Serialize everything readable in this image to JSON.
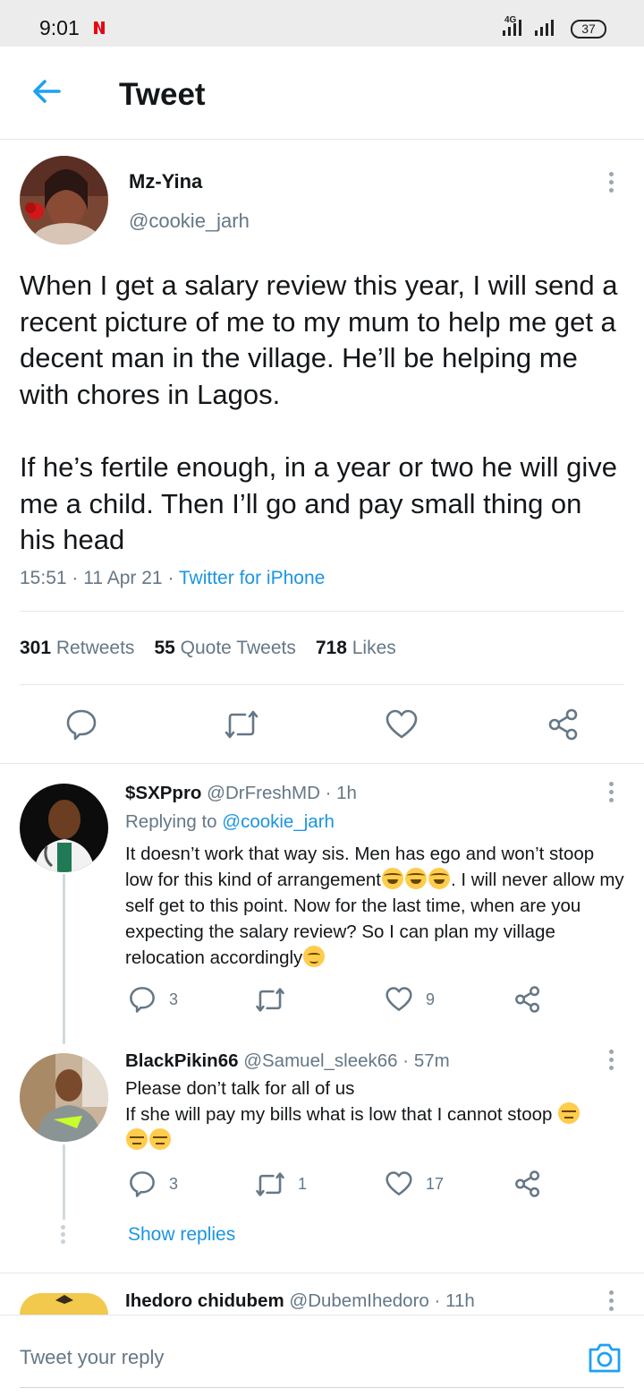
{
  "status_bar": {
    "time": "9:01",
    "network": "4G",
    "battery": "37"
  },
  "header": {
    "title": "Tweet"
  },
  "tweet": {
    "author_name": "Mz-Yina",
    "author_handle": "@cookie_jarh",
    "text": "When I get a salary review this year, I will send a recent picture of me to my mum to help me get a decent man in the village. He’ll be helping me with chores in Lagos.\n\nIf he’s fertile enough, in a year or two he will give me a child. Then I’ll go and pay small thing on his head",
    "time": "15:51",
    "date": "11 Apr 21",
    "source": "Twitter for iPhone",
    "retweets_count": "301",
    "retweets_label": "Retweets",
    "quotes_count": "55",
    "quotes_label": "Quote Tweets",
    "likes_count": "718",
    "likes_label": "Likes"
  },
  "replies": [
    {
      "name": "$SXPpro",
      "handle": "@DrFreshMD",
      "time": "1h",
      "replying_prefix": "Replying to",
      "replying_to": "@cookie_jarh",
      "text_part1": "It doesn’t work that way sis. Men has ego and won’t stoop low for this kind of arrangement",
      "text_part2": ".  I will never allow my self get to this point. Now for the last time, when are you expecting the salary review? So I can plan my village relocation accordingly",
      "replies": "3",
      "retweets": "",
      "likes": "9"
    },
    {
      "name": "BlackPikin66",
      "handle": "@Samuel_sleek66",
      "time": "57m",
      "text_line1": "Please don’t talk for all of us",
      "text_line2": "If she will pay my bills what is low that I cannot stoop",
      "replies": "3",
      "retweets": "1",
      "likes": "17"
    },
    {
      "name": "Ihedoro chidubem",
      "handle": "@DubemIhedoro",
      "time": "11h"
    }
  ],
  "show_replies": "Show replies",
  "composer": {
    "placeholder": "Tweet your reply"
  },
  "colors": {
    "accent": "#1b95e0",
    "muted": "#657786",
    "text": "#14171a"
  }
}
